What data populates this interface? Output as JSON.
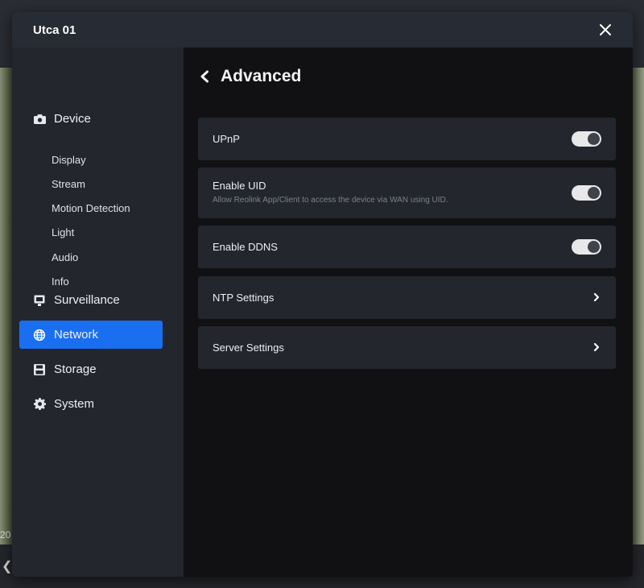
{
  "background": {
    "timestamp_fragment": "20"
  },
  "modal": {
    "title": "Utca 01"
  },
  "sidebar": {
    "groups": [
      {
        "label": "Device",
        "icon": "camera-icon"
      },
      {
        "label": "Surveillance",
        "icon": "monitor-icon"
      },
      {
        "label": "Network",
        "icon": "globe-icon",
        "active": true
      },
      {
        "label": "Storage",
        "icon": "floppy-icon"
      },
      {
        "label": "System",
        "icon": "gear-icon"
      }
    ],
    "device_items": [
      "Display",
      "Stream",
      "Motion Detection",
      "Light",
      "Audio",
      "Info"
    ]
  },
  "page": {
    "title": "Advanced"
  },
  "settings": [
    {
      "label": "UPnP",
      "type": "toggle",
      "enabled": false
    },
    {
      "label": "Enable UID",
      "description": "Allow Reolink App/Client to access the device via WAN using UID.",
      "type": "toggle",
      "enabled": false
    },
    {
      "label": "Enable DDNS",
      "type": "toggle",
      "enabled": false
    },
    {
      "label": "NTP Settings",
      "type": "link"
    },
    {
      "label": "Server Settings",
      "type": "link"
    }
  ],
  "colors": {
    "accent": "#1a6ff0",
    "panel": "#23262d",
    "header": "#272b33",
    "content_bg": "#111113"
  }
}
